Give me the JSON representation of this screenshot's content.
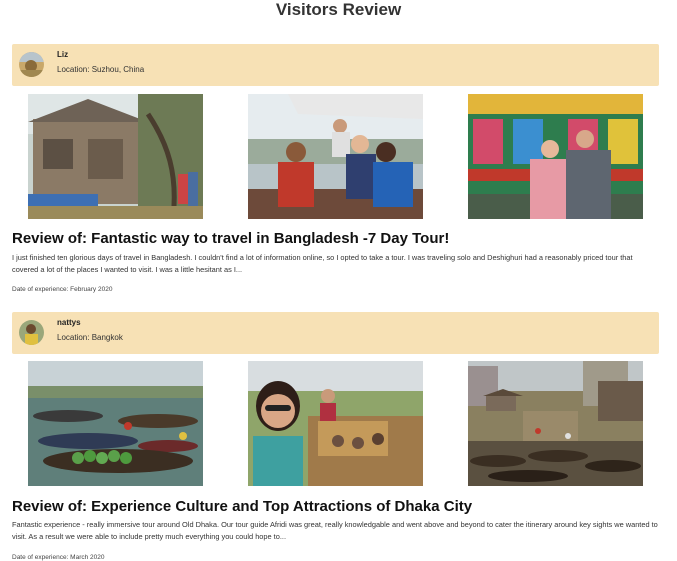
{
  "page": {
    "title": "Visitors Review"
  },
  "reviews": [
    {
      "reviewer": {
        "name": "Liz",
        "location": "Location: Suzhou, China"
      },
      "title": "Review of: Fantastic way to travel in Bangladesh -7 Day Tour!",
      "text": "I just finished ten glorious days of travel in Bangladesh. I couldn't find a lot of information online, so I opted to take a tour. I was traveling solo and Deshighuri had a reasonably priced tour that covered a lot of the places I wanted to visit. I was a little hesitant as I...",
      "date": "Date of experience: February 2020",
      "photos": [
        "wooden-house-photo",
        "boat-tourists-photo",
        "rickshaw-couple-photo"
      ]
    },
    {
      "reviewer": {
        "name": "nattys",
        "location": "Location: Bangkok"
      },
      "title": "Review of: Experience Culture and Top Attractions of Dhaka City",
      "text": "Fantastic experience - really immersive tour around Old Dhaka. Our tour guide Afridi was great, really knowledgable and went above and beyond to cater the itinerary around key sights we wanted to visit. As a result we were able to include pretty much everything you could hope to...",
      "date": "Date of experience: March 2020",
      "photos": [
        "floating-market-photo",
        "selfie-market-photo",
        "river-boats-photo"
      ]
    }
  ]
}
